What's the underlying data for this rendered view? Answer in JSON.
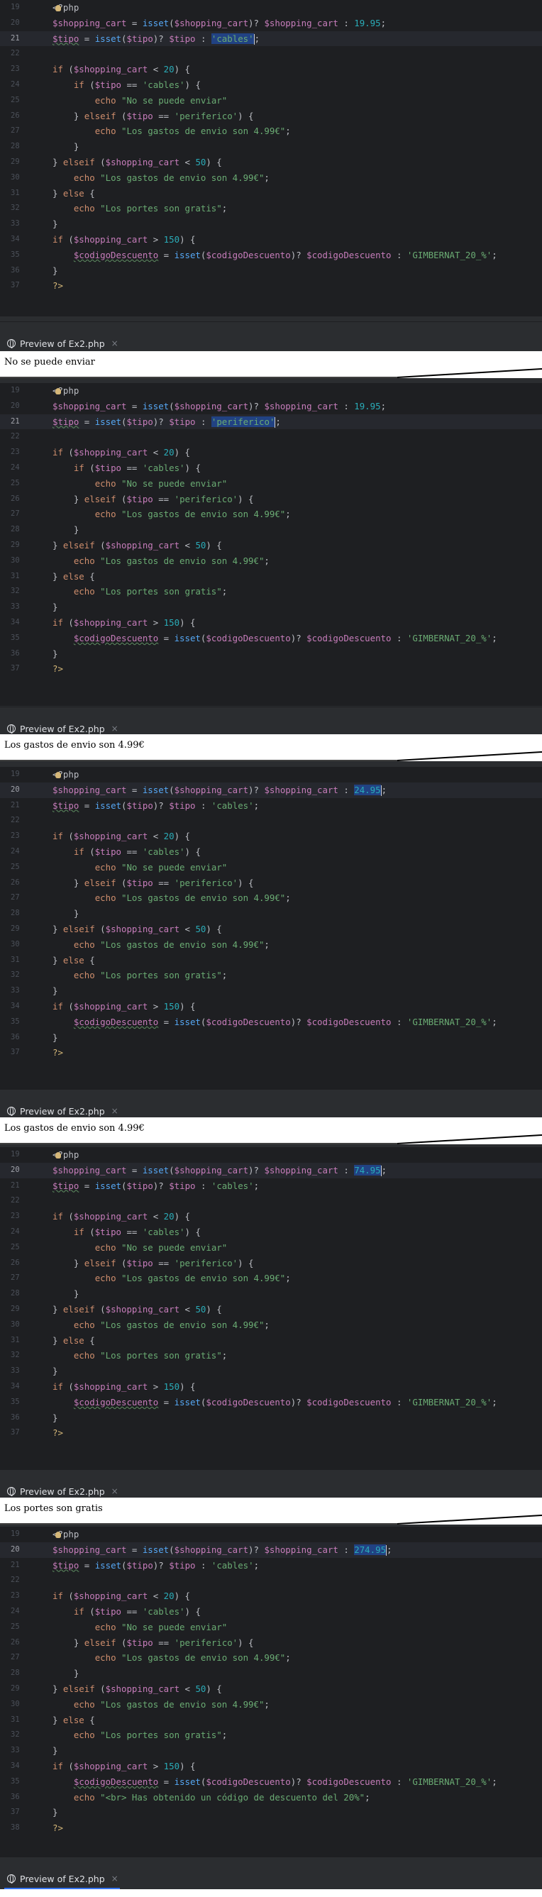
{
  "preview_tab": {
    "title": "Preview of Ex2.php",
    "close": "×"
  },
  "outputs": [
    "No se puede enviar",
    "Los gastos de envio son 4.99€",
    "Los gastos de envio son 4.99€",
    "Los portes son gratis"
  ],
  "panels": [
    {
      "cart_value": "19.95",
      "tipo_value": "'cables'",
      "selected": "tipo",
      "current_line": 21
    },
    {
      "cart_value": "19.95",
      "tipo_value": "'periferico'",
      "selected": "tipo",
      "current_line": 21
    },
    {
      "cart_value": "24.95",
      "tipo_value": "'cables'",
      "selected": "cart",
      "current_line": 20
    },
    {
      "cart_value": "74.95",
      "tipo_value": "'cables'",
      "selected": "cart",
      "current_line": 20
    },
    {
      "cart_value": "274.95",
      "tipo_value": "'cables'",
      "selected": "cart",
      "current_line": 20
    }
  ],
  "code": {
    "open_tag": "<?php",
    "close_tag": "?>",
    "cart_var": "$shopping_cart",
    "tipo_var": "$tipo",
    "codigo_var": "$codigoDescuento",
    "isset": "isset",
    "if_kw": "if",
    "elseif_kw": "elseif",
    "else_kw": "else",
    "echo_kw": "echo",
    "str_cables": "'cables'",
    "str_periferico": "'periferico'",
    "msg_no_enviar": "\"No se puede enviar\"",
    "msg_gastos": "\"Los gastos de envio son 4.99€\"",
    "msg_portes": "\"Los portes son gratis\"",
    "discount_code": "'GIMBERNAT_20_%'",
    "msg_descuento": "\"<br> Has obtenido un código de descuento del 20%\"",
    "num_20": "20",
    "num_50": "50",
    "num_150": "150"
  }
}
